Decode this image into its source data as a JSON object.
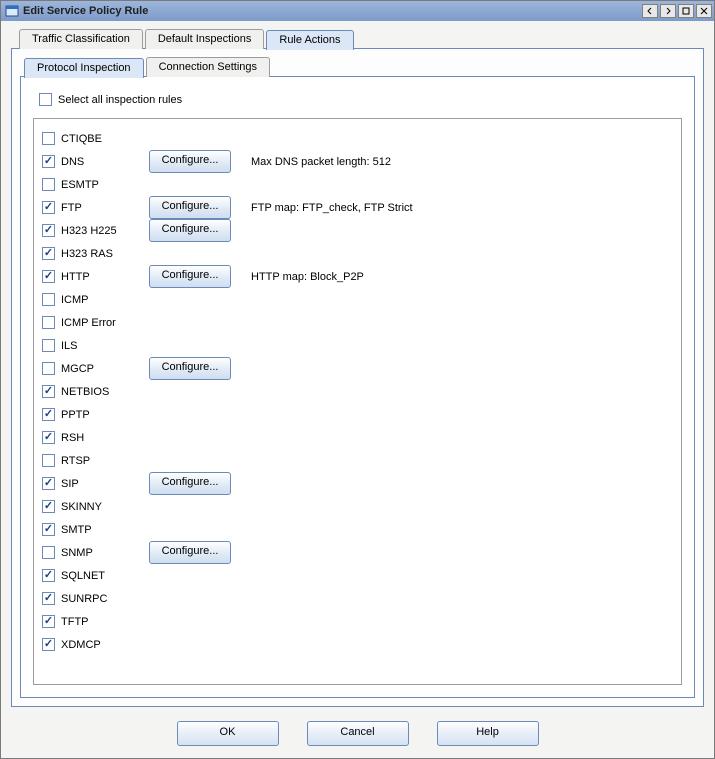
{
  "window": {
    "title": "Edit Service Policy Rule"
  },
  "outerTabs": [
    {
      "label": "Traffic Classification",
      "active": false
    },
    {
      "label": "Default Inspections",
      "active": false
    },
    {
      "label": "Rule Actions",
      "active": true
    }
  ],
  "innerTabs": [
    {
      "label": "Protocol Inspection",
      "active": true
    },
    {
      "label": "Connection Settings",
      "active": false
    }
  ],
  "selectAll": {
    "label": "Select all inspection rules",
    "checked": false
  },
  "configureLabel": "Configure...",
  "rules": [
    {
      "name": "CTIQBE",
      "checked": false,
      "configure": false,
      "detail": ""
    },
    {
      "name": "DNS",
      "checked": true,
      "configure": true,
      "detail": "Max DNS packet length: 512"
    },
    {
      "name": "ESMTP",
      "checked": false,
      "configure": false,
      "detail": ""
    },
    {
      "name": "FTP",
      "checked": true,
      "configure": true,
      "detail": "FTP map: FTP_check, FTP Strict"
    },
    {
      "name": "H323 H225",
      "checked": true,
      "configure": true,
      "detail": ""
    },
    {
      "name": "H323 RAS",
      "checked": true,
      "configure": false,
      "detail": ""
    },
    {
      "name": "HTTP",
      "checked": true,
      "configure": true,
      "detail": "HTTP map: Block_P2P"
    },
    {
      "name": "ICMP",
      "checked": false,
      "configure": false,
      "detail": ""
    },
    {
      "name": "ICMP Error",
      "checked": false,
      "configure": false,
      "detail": ""
    },
    {
      "name": "ILS",
      "checked": false,
      "configure": false,
      "detail": ""
    },
    {
      "name": "MGCP",
      "checked": false,
      "configure": true,
      "detail": ""
    },
    {
      "name": "NETBIOS",
      "checked": true,
      "configure": false,
      "detail": ""
    },
    {
      "name": "PPTP",
      "checked": true,
      "configure": false,
      "detail": ""
    },
    {
      "name": "RSH",
      "checked": true,
      "configure": false,
      "detail": ""
    },
    {
      "name": "RTSP",
      "checked": false,
      "configure": false,
      "detail": ""
    },
    {
      "name": "SIP",
      "checked": true,
      "configure": true,
      "detail": ""
    },
    {
      "name": "SKINNY",
      "checked": true,
      "configure": false,
      "detail": ""
    },
    {
      "name": "SMTP",
      "checked": true,
      "configure": false,
      "detail": ""
    },
    {
      "name": "SNMP",
      "checked": false,
      "configure": true,
      "detail": ""
    },
    {
      "name": "SQLNET",
      "checked": true,
      "configure": false,
      "detail": ""
    },
    {
      "name": "SUNRPC",
      "checked": true,
      "configure": false,
      "detail": ""
    },
    {
      "name": "TFTP",
      "checked": true,
      "configure": false,
      "detail": ""
    },
    {
      "name": "XDMCP",
      "checked": true,
      "configure": false,
      "detail": ""
    }
  ],
  "buttons": {
    "ok": "OK",
    "cancel": "Cancel",
    "help": "Help"
  }
}
